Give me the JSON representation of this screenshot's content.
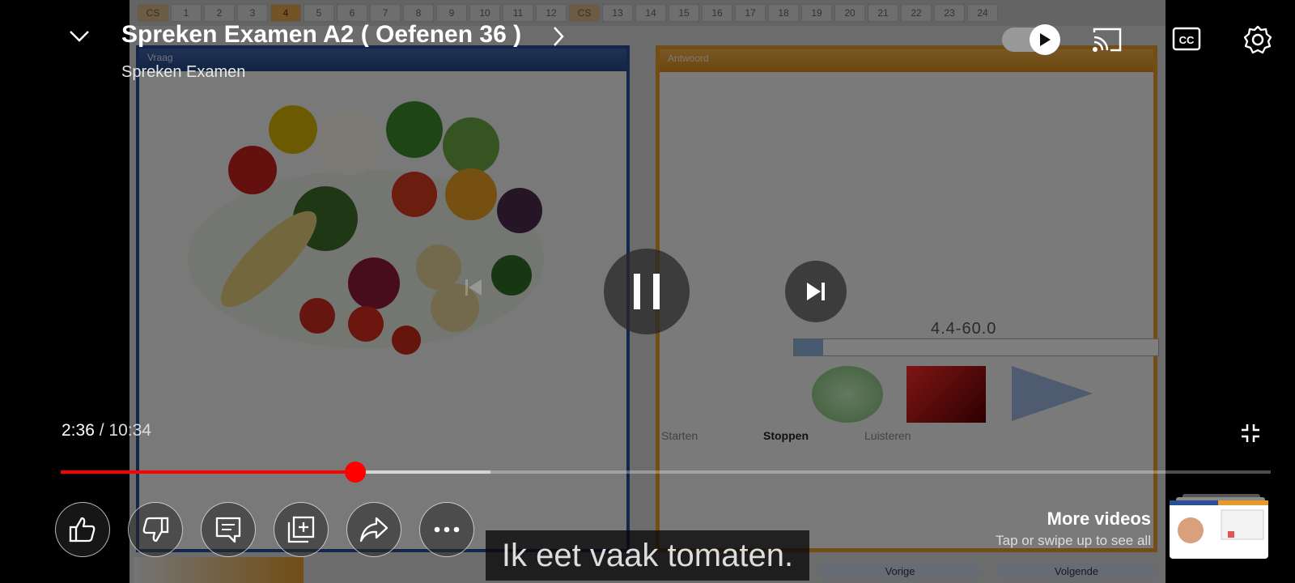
{
  "video": {
    "tabs": [
      "CS",
      "1",
      "2",
      "3",
      "4",
      "5",
      "6",
      "7",
      "8",
      "9",
      "10",
      "11",
      "12",
      "CS",
      "13",
      "14",
      "15",
      "16",
      "17",
      "18",
      "19",
      "20",
      "21",
      "22",
      "23",
      "24"
    ],
    "left_panel_header": "Vraag",
    "right_panel_header": "Antwoord",
    "timer": "4.4-60.0",
    "record_progress": 0.08,
    "buttons": {
      "start": "Starten",
      "stop": "Stoppen",
      "listen": "Luisteren"
    },
    "nav": {
      "prev": "Vorige",
      "next": "Volgende"
    },
    "subtitle": "Ik eet vaak tomaten."
  },
  "header": {
    "title": "Spreken Examen A2 ( Oefenen 36 )",
    "channel": "Spreken Examen",
    "icons": [
      "chevron-down-icon",
      "chevron-right-icon",
      "autoplay-toggle",
      "cast-icon",
      "cc-icon",
      "gear-icon"
    ]
  },
  "player": {
    "current_time": "2:36",
    "separator": "/",
    "duration": "10:34",
    "played_fraction": 0.2435,
    "buffered_fraction": 0.3555,
    "autoplay_on": true
  },
  "actions": [
    "like",
    "dislike",
    "comments",
    "save-to-playlist",
    "share",
    "more"
  ],
  "more_videos": {
    "title": "More videos",
    "hint": "Tap or swipe up to see all"
  },
  "colors": {
    "accent": "#ff0000",
    "overlay": "#000000"
  }
}
